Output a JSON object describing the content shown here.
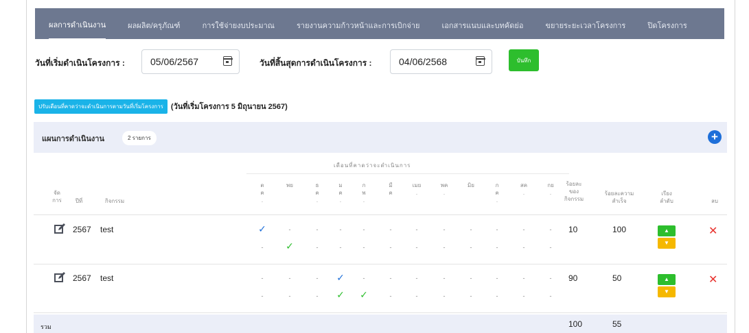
{
  "tabs": [
    {
      "label": "ผลการดำเนินงาน",
      "active": true
    },
    {
      "label": "ผลผลิต/ครุภัณฑ์"
    },
    {
      "label": "การใช้จ่ายงบประมาณ"
    },
    {
      "label": "รายงานความก้าวหน้าและการเบิกจ่าย"
    },
    {
      "label": "เอกสารแนบและบทคัดย่อ"
    },
    {
      "label": "ขยายระยะเวลาโครงการ"
    },
    {
      "label": "ปิดโครงการ"
    }
  ],
  "dates": {
    "start_label": "วันที่เริ่มดำเนินโครงการ :",
    "start_value": "05/06/2567",
    "end_label": "วันที่สิ้นสุดการดำเนินโครงการ :",
    "end_value": "04/06/2568",
    "save_label": "บันทึก"
  },
  "adjust": {
    "button_label": "ปรับเดือนที่คาดว่าจะดำเนินการตามวันที่เริ่มโครงการ",
    "note": "(วันที่เริ่มโครงการ 5 มิถุนายน 2567)"
  },
  "plan": {
    "title": "แผนการดำเนินงาน",
    "count": "2 รายการ",
    "add_icon": "+"
  },
  "table": {
    "months_header": "เดือนที่คาดว่าจะดำเนินการ",
    "col_manage": [
      "จัด",
      "การ"
    ],
    "col_year": "ปีที่",
    "col_activity": "กิจกรรม",
    "months": [
      [
        "ต",
        "ค",
        "."
      ],
      [
        "พย",
        "",
        ""
      ],
      [
        "ธ",
        "ค",
        "."
      ],
      [
        "ม",
        "ค",
        "."
      ],
      [
        "ก",
        "พ",
        "."
      ],
      [
        "มี",
        "ค",
        ""
      ],
      [
        "เมย",
        "",
        "."
      ],
      [
        "พค",
        "",
        "."
      ],
      [
        "มิย",
        "",
        ""
      ],
      [
        "ก",
        "ค",
        "."
      ],
      [
        "สค",
        "",
        "."
      ],
      [
        "กย",
        "",
        "."
      ]
    ],
    "col_pct_activity": [
      "ร้อยละ",
      "ของ",
      "กิจกรรม"
    ],
    "col_pct_success": [
      "ร้อยละความ",
      "สำเร็จ"
    ],
    "col_order": [
      "เรียง",
      "ลำดับ"
    ],
    "col_delete": "ลบ",
    "rows": [
      {
        "year": "2567",
        "activity": "test",
        "plan_months": [
          1,
          0,
          0,
          0,
          0,
          0,
          0,
          0,
          0,
          0,
          0,
          0
        ],
        "actual_months": [
          0,
          1,
          0,
          0,
          0,
          0,
          0,
          0,
          0,
          0,
          0,
          0
        ],
        "pct_activity": "10",
        "pct_success": "100"
      },
      {
        "year": "2567",
        "activity": "test",
        "plan_months": [
          0,
          0,
          0,
          1,
          0,
          0,
          0,
          0,
          0,
          0,
          0,
          0
        ],
        "actual_months": [
          0,
          0,
          0,
          1,
          1,
          0,
          0,
          0,
          0,
          0,
          0,
          0
        ],
        "pct_activity": "90",
        "pct_success": "50"
      }
    ],
    "summary": {
      "label": "รวม",
      "pct_activity": "100",
      "pct_success": "55"
    },
    "dash": "-",
    "check": "✓",
    "up_icon": "▲",
    "down_icon": "▼",
    "delete_icon": "✕"
  },
  "colors": {
    "tabbar": "#6d7890",
    "plan_check": "#1e6fd9",
    "actual_check": "#2dbe2d",
    "up": "#2dbe2d",
    "down": "#f5b800",
    "delete": "#e8322e",
    "adjust_button": "#1ab3e8"
  }
}
